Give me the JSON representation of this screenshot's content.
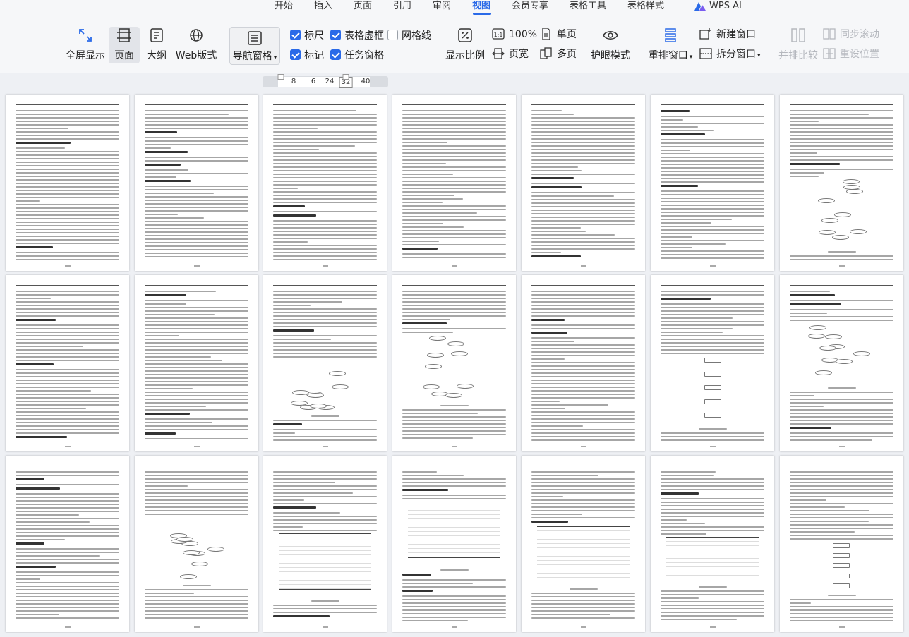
{
  "menu": {
    "items": [
      "开始",
      "插入",
      "页面",
      "引用",
      "审阅",
      "视图",
      "会员专享",
      "表格工具",
      "表格样式"
    ],
    "active": "视图",
    "ai_label": "WPS AI"
  },
  "ribbon": {
    "fullscreen": "全屏显示",
    "page": "页面",
    "outline": "大纲",
    "web": "Web版式",
    "nav_pane": "导航窗格",
    "ruler": "标尺",
    "table_gridlines": "表格虚框",
    "gridlines": "网格线",
    "marks": "标记",
    "task_pane": "任务窗格",
    "zoom": "显示比例",
    "zoom100": "100%",
    "page_width": "页宽",
    "single_page": "单页",
    "multi_page": "多页",
    "eye_mode": "护眼模式",
    "rearrange": "重排窗口",
    "new_window": "新建窗口",
    "split_window": "拆分窗口",
    "side_by_side": "并排比较",
    "sync_scroll": "同步滚动",
    "reset_position": "重设位置"
  },
  "checkbox_state": {
    "ruler": true,
    "table_gridlines": true,
    "gridlines": false,
    "marks": true,
    "task_pane": true
  },
  "ruler": {
    "ticks": [
      "8",
      "6",
      "24",
      "32",
      "40"
    ]
  },
  "colors": {
    "accent": "#2a6ae8",
    "ribbon_bg": "#f6f7f9",
    "doc_bg": "#eef0f4"
  }
}
